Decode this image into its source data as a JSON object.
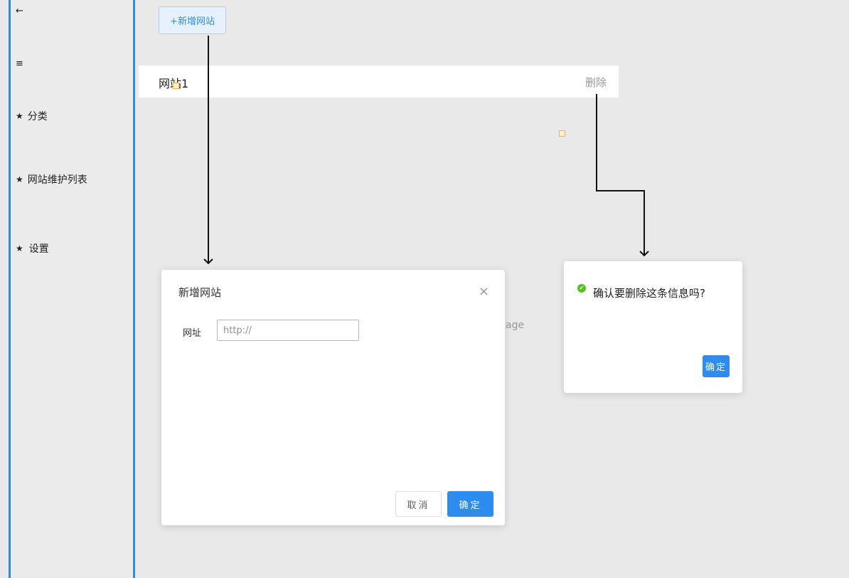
{
  "sidebar": {
    "back_icon": "←",
    "menu_icon": "≡",
    "star": "★",
    "items": [
      {
        "label": "分类"
      },
      {
        "label": "网站维护列表"
      },
      {
        "label": "设置"
      }
    ]
  },
  "toolbar": {
    "add_label": "+新增网站"
  },
  "list": {
    "rows": [
      {
        "name": "网站1",
        "delete_label": "删除"
      }
    ]
  },
  "background_text": "age",
  "add_dialog": {
    "title": "新增网站",
    "close_icon": "×",
    "field_label": "网址",
    "url_value": "",
    "url_placeholder": "http://",
    "cancel_label": "取消",
    "ok_label": "确定"
  },
  "confirm_dialog": {
    "message": "确认要删除这条信息吗?",
    "icon": "success-check-icon",
    "icon_glyph": "✔",
    "ok_label": "确定"
  },
  "colors": {
    "accent": "#2d8cf0",
    "success": "#52c41a"
  }
}
